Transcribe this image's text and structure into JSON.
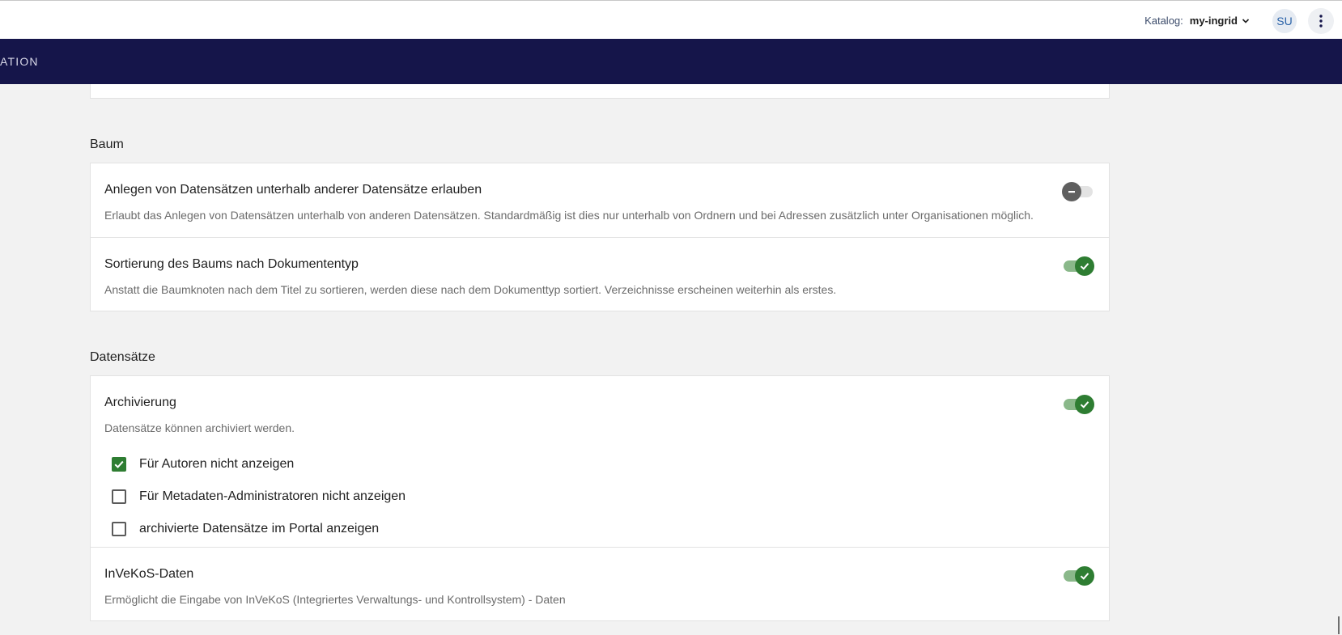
{
  "header": {
    "catalog_label": "Katalog:",
    "catalog_value": "my-ingrid",
    "avatar_initials": "SU"
  },
  "nav": {
    "label": "ATION"
  },
  "sections": {
    "baum": {
      "title": "Baum",
      "items": [
        {
          "title": "Anlegen von Datensätzen unterhalb anderer Datensätze erlauben",
          "description": "Erlaubt das Anlegen von Datensätzen unterhalb von anderen Datensätzen. Standardmäßig ist dies nur unterhalb von Ordnern und bei Adressen zusätzlich unter Organisationen möglich.",
          "enabled": false
        },
        {
          "title": "Sortierung des Baums nach Dokumententyp",
          "description": "Anstatt die Baumknoten nach dem Titel zu sortieren, werden diese nach dem Dokumenttyp sortiert. Verzeichnisse erscheinen weiterhin als erstes.",
          "enabled": true
        }
      ]
    },
    "datensaetze": {
      "title": "Datensätze",
      "items": [
        {
          "title": "Archivierung",
          "description": "Datensätze können archiviert werden.",
          "enabled": true,
          "options": [
            {
              "label": "Für Autoren nicht anzeigen",
              "checked": true
            },
            {
              "label": "Für Metadaten-Administratoren nicht anzeigen",
              "checked": false
            },
            {
              "label": "archivierte Datensätze im Portal anzeigen",
              "checked": false
            }
          ]
        },
        {
          "title": "InVeKoS-Daten",
          "description": "Ermöglicht die Eingabe von InVeKoS (Integriertes Verwaltungs- und Kontrollsystem) - Daten",
          "enabled": true
        }
      ]
    }
  },
  "colors": {
    "navbar": "#15154a",
    "toggle_on": "#2e7d32",
    "toggle_off": "#5f5f5f",
    "checkbox_checked": "#2e7d32"
  },
  "icons": {
    "dropdown": "chevron-down-icon",
    "menu": "more-vert-icon",
    "toggle_on": "check-icon",
    "toggle_off": "minus-icon"
  }
}
